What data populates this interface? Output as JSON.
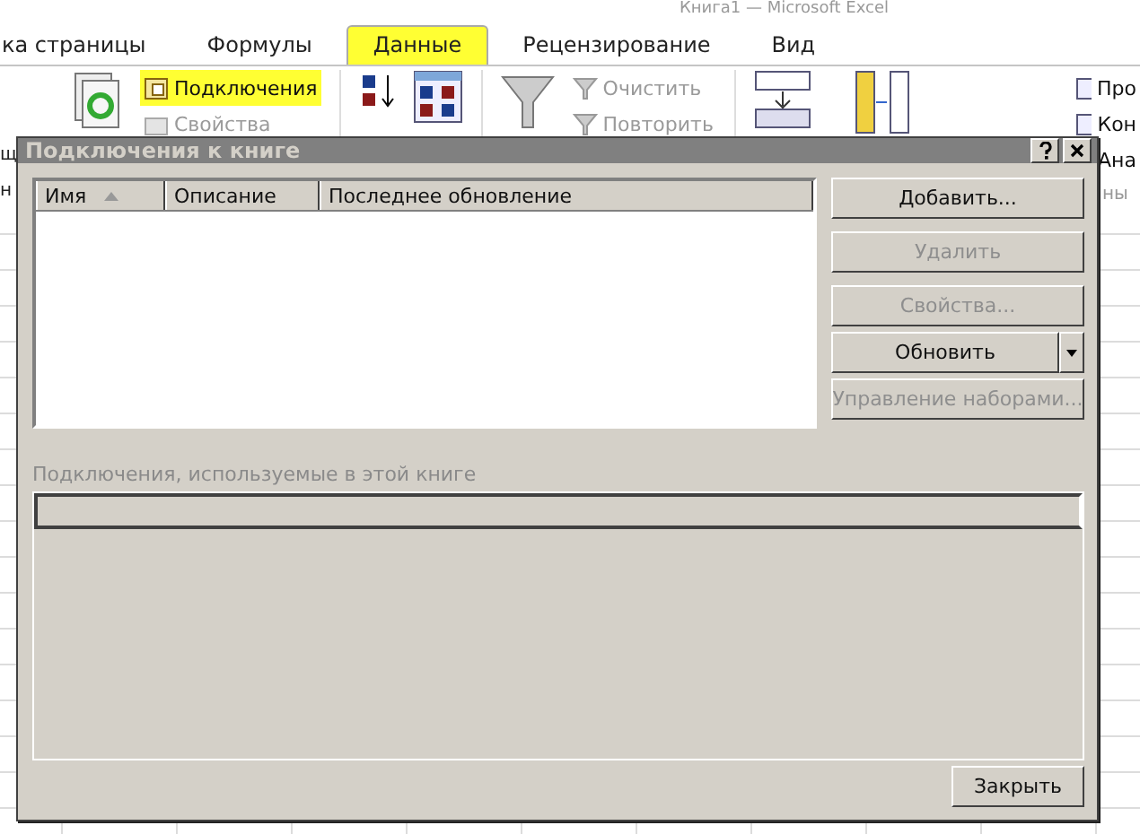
{
  "app_title": "Книга1 — Microsoft Excel",
  "tabs": [
    {
      "label": "ка страницы",
      "selected": false
    },
    {
      "label": "Формулы",
      "selected": false
    },
    {
      "label": "Данные",
      "selected": true
    },
    {
      "label": "Рецензирование",
      "selected": false
    },
    {
      "label": "Вид",
      "selected": false
    }
  ],
  "ribbon": {
    "connections": {
      "label": "Подключения",
      "highlighted": true
    },
    "properties": {
      "label": "Свойства",
      "disabled": true
    },
    "clear": {
      "label": "Очистить",
      "disabled": true
    },
    "reapply": {
      "label": "Повторить",
      "disabled": true
    },
    "right_items": [
      "Про",
      "Кон",
      "Ана"
    ],
    "left_cut": [
      "щ",
      "н"
    ],
    "right_cut": "ны"
  },
  "dialog": {
    "title": "Подключения к книге",
    "columns": [
      {
        "label": "Имя",
        "sorted": true
      },
      {
        "label": "Описание",
        "sorted": false
      },
      {
        "label": "Последнее обновление",
        "sorted": false
      }
    ],
    "buttons": [
      {
        "label": "Добавить...",
        "disabled": false,
        "kind": "plain"
      },
      {
        "label": "Удалить",
        "disabled": true,
        "kind": "plain"
      },
      {
        "label": "Свойства...",
        "disabled": true,
        "kind": "plain"
      },
      {
        "label": "Обновить",
        "disabled": false,
        "kind": "split"
      },
      {
        "label": "Управление наборами...",
        "disabled": true,
        "kind": "plain"
      }
    ],
    "used_label": "Подключения, используемые в этой книге",
    "close": "Закрыть"
  }
}
